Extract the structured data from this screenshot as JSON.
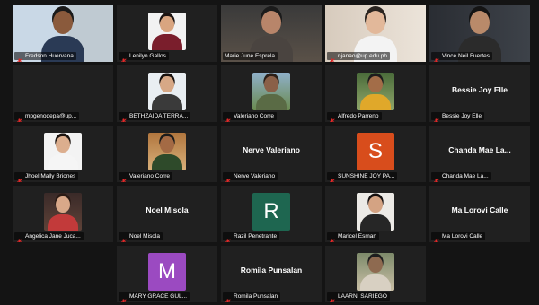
{
  "participants": [
    {
      "name": "Fredson Huervana",
      "kind": "video",
      "muted": true
    },
    {
      "name": "Lenilyn Gallos",
      "kind": "photo",
      "muted": true
    },
    {
      "name": "Marie June Esprela",
      "kind": "video",
      "muted": false,
      "active_speaker": true
    },
    {
      "name": "njanao@up.edu.ph",
      "kind": "video",
      "muted": true
    },
    {
      "name": "Vince Neil Fuertes",
      "kind": "video",
      "muted": true
    },
    {
      "name": "mpgenodepa@up...",
      "kind": "none",
      "muted": true
    },
    {
      "name": "BETHZAIDA TERRA...",
      "kind": "photo",
      "muted": true
    },
    {
      "name": "Valeriano Corre",
      "kind": "photo",
      "muted": true
    },
    {
      "name": "Alfredo Parreno",
      "kind": "photo",
      "muted": true
    },
    {
      "name": "Bessie Joy Elle",
      "kind": "text",
      "muted": true
    },
    {
      "name": "Jhoel Mally Briones",
      "kind": "photo",
      "muted": true
    },
    {
      "name": "Valeriano Corre",
      "kind": "photo",
      "muted": true
    },
    {
      "name": "Nerve Valeriano",
      "kind": "text",
      "muted": true
    },
    {
      "name": "SUNSHINE JOY PA...",
      "kind": "avatar",
      "letter": "S",
      "color": "#d84d1c",
      "muted": true
    },
    {
      "name": "Chanda Mae La...",
      "kind": "text",
      "muted": true
    },
    {
      "name": "Angelica Jane Juca...",
      "kind": "photo",
      "muted": true
    },
    {
      "name": "Noel Misola",
      "kind": "text",
      "muted": true
    },
    {
      "name": "Razil Penetrante",
      "kind": "avatar",
      "letter": "R",
      "color": "#1e6650",
      "muted": true
    },
    {
      "name": "Maricel Esman",
      "kind": "photo",
      "muted": true
    },
    {
      "name": "Ma Lorovi Calle",
      "kind": "text",
      "muted": true
    },
    {
      "name": "MARY GRACE GUL...",
      "kind": "avatar",
      "letter": "M",
      "color": "#9b4ac1",
      "muted": true
    },
    {
      "name": "Romila Punsalan",
      "kind": "text",
      "muted": true
    },
    {
      "name": "LAARNI SARIEGO",
      "kind": "photo",
      "muted": true
    }
  ],
  "colors": {
    "background": "#141414",
    "tile": "#202020",
    "active_border": "#c9e265",
    "muted_icon": "#e02828"
  }
}
